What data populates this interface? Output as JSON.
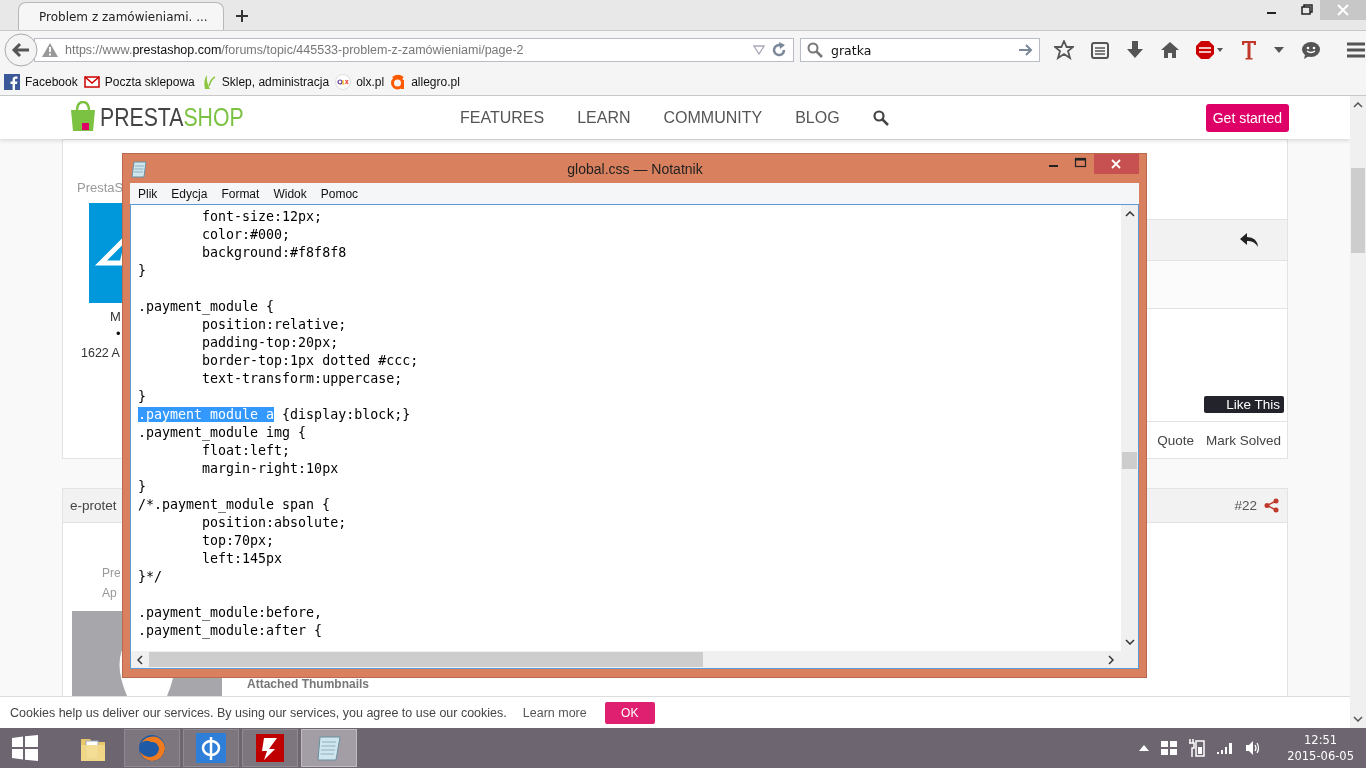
{
  "browser": {
    "tabs": [
      {
        "title": "Problem z zamówieniami. ...",
        "selected": true
      }
    ],
    "url": {
      "prefix": "https://www.",
      "domain": "prestashop.com",
      "path": "/forums/topic/445533-problem-z-zamówieniami/page-2"
    },
    "search": {
      "value": "gratka"
    },
    "bookmarks": [
      {
        "label": "Facebook",
        "kind": "facebook"
      },
      {
        "label": "Poczta sklepowa",
        "kind": "mail"
      },
      {
        "label": "Sklep, administracja",
        "kind": "leaf"
      },
      {
        "label": "olx.pl",
        "kind": "olx"
      },
      {
        "label": "allegro.pl",
        "kind": "allegro"
      }
    ]
  },
  "site_header": {
    "logo_prefix": "PRESTA",
    "logo_suffix": "SHOP",
    "nav": [
      "FEATURES",
      "LEARN",
      "COMMUNITY",
      "BLOG"
    ],
    "cta": "Get started"
  },
  "posts": [
    {
      "author": "PrestaS",
      "initial": "M",
      "bullet": "•",
      "stats": "1622 A",
      "like_button": "Like This",
      "actions": [
        "Quote",
        "Mark Solved"
      ]
    },
    {
      "author": "e-protet",
      "number": "#22",
      "lines": [
        "Pre",
        "Ap"
      ],
      "attachments_title": "Attached Thumbnails"
    }
  ],
  "notepad": {
    "title": "global.css — Notatnik",
    "menu": [
      "Plik",
      "Edycja",
      "Format",
      "Widok",
      "Pomoc"
    ],
    "lines": [
      {
        "kind": "code",
        "text": "\tfont-size:12px;"
      },
      {
        "kind": "code",
        "text": "\tcolor:#000;"
      },
      {
        "kind": "code",
        "text": "\tbackground:#f8f8f8"
      },
      {
        "kind": "code",
        "text": "}"
      },
      {
        "kind": "blank"
      },
      {
        "kind": "code",
        "text": ".payment_module {"
      },
      {
        "kind": "code",
        "text": "\tposition:relative;"
      },
      {
        "kind": "code",
        "text": "\tpadding-top:20px;"
      },
      {
        "kind": "code",
        "text": "\tborder-top:1px dotted #ccc;"
      },
      {
        "kind": "code",
        "text": "\ttext-transform:uppercase;"
      },
      {
        "kind": "code",
        "text": "}"
      },
      {
        "kind": "code",
        "selected_text": ".payment_module a",
        "text": " {display:block;}"
      },
      {
        "kind": "code",
        "text": ".payment_module img {"
      },
      {
        "kind": "code",
        "text": "\tfloat:left;"
      },
      {
        "kind": "code",
        "text": "\tmargin-right:10px"
      },
      {
        "kind": "code",
        "text": "}"
      },
      {
        "kind": "code",
        "text": "/*.payment_module span {"
      },
      {
        "kind": "code",
        "text": "\tposition:absolute;"
      },
      {
        "kind": "code",
        "text": "\ttop:70px;"
      },
      {
        "kind": "code",
        "text": "\tleft:145px"
      },
      {
        "kind": "code",
        "text": "}*/"
      },
      {
        "kind": "blank"
      },
      {
        "kind": "code",
        "text": ".payment_module:before,"
      },
      {
        "kind": "code",
        "text": ".payment_module:after {"
      }
    ]
  },
  "cookie_bar": {
    "text": "Cookies help us deliver our services. By using our services, you agree to use our cookies.",
    "link": "Learn more",
    "button": "OK"
  },
  "taskbar": {
    "apps": [
      {
        "kind": "folder",
        "running": false,
        "selected": false
      },
      {
        "kind": "firefox",
        "running": true,
        "selected": false
      },
      {
        "kind": "phi",
        "running": true,
        "selected": false
      },
      {
        "kind": "filezilla",
        "running": true,
        "selected": false
      },
      {
        "kind": "notepad",
        "running": true,
        "selected": true
      }
    ],
    "time": "12:51",
    "date": "2015-06-05"
  }
}
